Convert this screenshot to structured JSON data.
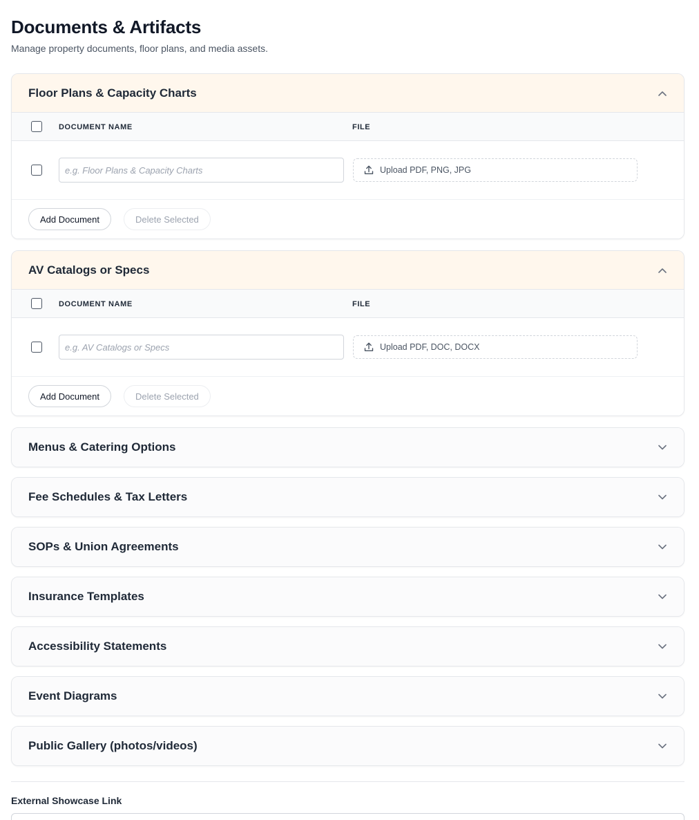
{
  "page": {
    "title": "Documents & Artifacts",
    "subtitle": "Manage property documents, floor plans, and media assets."
  },
  "table_headers": {
    "document_name": "DOCUMENT NAME",
    "file": "FILE"
  },
  "buttons": {
    "add_document": "Add Document",
    "delete_selected": "Delete Selected"
  },
  "sections": [
    {
      "title": "Floor Plans & Capacity Charts",
      "expanded": true,
      "row": {
        "name_value": "",
        "name_placeholder": "e.g. Floor Plans & Capacity Charts",
        "upload_label": "Upload PDF, PNG, JPG"
      }
    },
    {
      "title": "AV Catalogs or Specs",
      "expanded": true,
      "row": {
        "name_value": "",
        "name_placeholder": "e.g. AV Catalogs or Specs",
        "upload_label": "Upload PDF, DOC, DOCX"
      }
    },
    {
      "title": "Menus & Catering Options",
      "expanded": false
    },
    {
      "title": "Fee Schedules & Tax Letters",
      "expanded": false
    },
    {
      "title": "SOPs & Union Agreements",
      "expanded": false
    },
    {
      "title": "Insurance Templates",
      "expanded": false
    },
    {
      "title": "Accessibility Statements",
      "expanded": false
    },
    {
      "title": "Event Diagrams",
      "expanded": false
    },
    {
      "title": "Public Gallery (photos/videos)",
      "expanded": false
    }
  ],
  "external_link": {
    "label": "External Showcase Link",
    "value": ""
  },
  "icons": {
    "expanded": "chevron-up-icon",
    "collapsed": "chevron-down-icon",
    "upload": "upload-icon"
  },
  "colors": {
    "expanded_header_bg": "#fff7ed",
    "border": "#e5e7eb",
    "muted_text": "#9ca3af"
  }
}
